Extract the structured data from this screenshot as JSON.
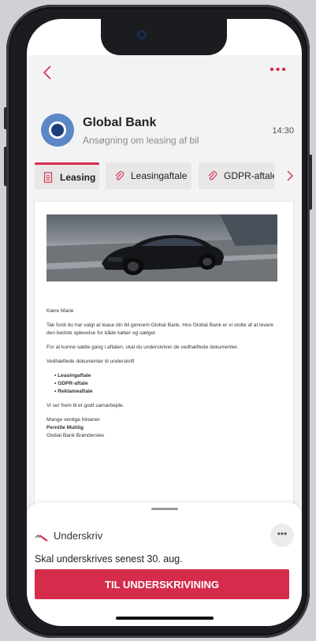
{
  "colors": {
    "accent": "#d62c4c",
    "background": "#f4f3f3"
  },
  "topbar": {
    "back_icon": "chevron-left-icon",
    "more_label": "•••"
  },
  "sender": {
    "name": "Global Bank",
    "subject": "Ansøgning om leasing af bil",
    "time": "14:30",
    "avatar_icon": "bank-logo-icon"
  },
  "tabs": [
    {
      "label": "Leasing",
      "icon": "document-icon",
      "active": true
    },
    {
      "label": "Leasingaftale",
      "icon": "paperclip-icon",
      "active": false
    },
    {
      "label": "GDPR-aftale",
      "icon": "paperclip-icon",
      "active": false
    }
  ],
  "tabs_next_icon": "chevron-right-icon",
  "mail": {
    "image": "car-photo",
    "greeting": "Kære Marie",
    "para1": "Tak fordi du har valgt at lease din bil gennem Global Bank. Hos Global Bank er vi stolte af at levere den bedste oplevelse for både køber og sælger.",
    "para2": "For at kunne sætte gang i aftalen, skal du underskriver de vedhæftede dokumenter.",
    "attachments_heading": "Vedhæftede dokumenter til underskrift",
    "attachments": [
      "Leasingaftale",
      "GDPR-aftale",
      "Reklameaftale"
    ],
    "closing": "Vi ser frem til et godt samarbejde.",
    "regards": "Mange venlige hilsener",
    "signer": "Pernille Muhlig",
    "branch": "Global Bank Brønderslev"
  },
  "sheet": {
    "sign_label": "Underskriv",
    "sign_icon": "signature-icon",
    "more_label": "•••",
    "deadline": "Skal underskrives senest 30. aug.",
    "cta_label": "TIL UNDERSKRIVINING"
  }
}
